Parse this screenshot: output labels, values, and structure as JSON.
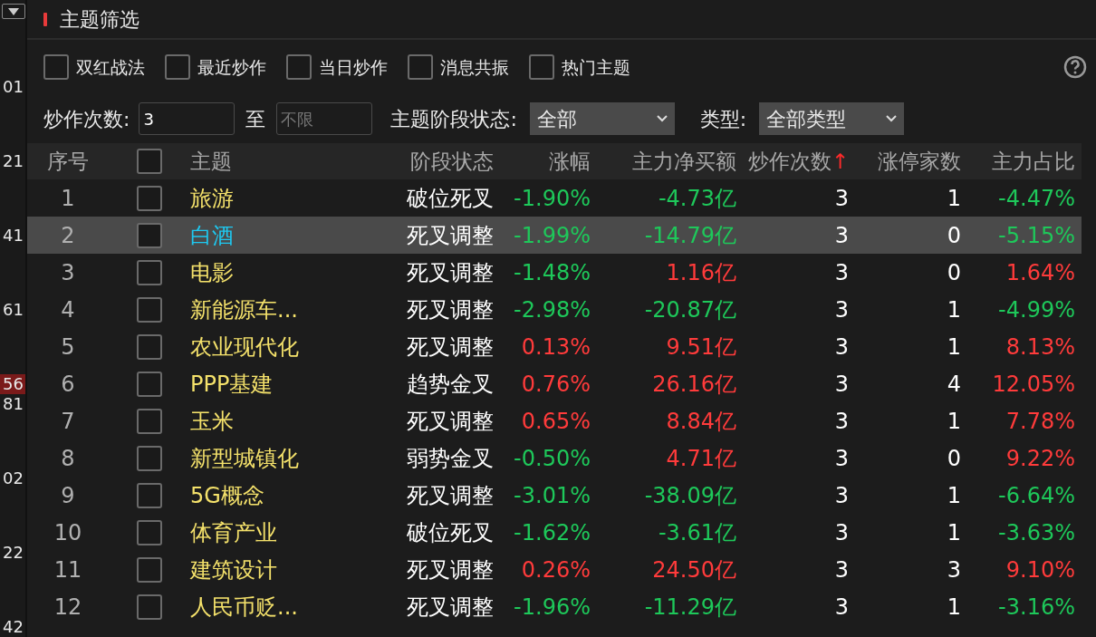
{
  "left_panel": {
    "values": [
      {
        "text": "01",
        "highlighted": false
      },
      {
        "text": "21",
        "highlighted": false
      },
      {
        "text": "41",
        "highlighted": false
      },
      {
        "text": "61",
        "highlighted": false
      },
      {
        "text": "56",
        "highlighted": true
      },
      {
        "text": "81",
        "highlighted": false
      },
      {
        "text": "02",
        "highlighted": false
      },
      {
        "text": "22",
        "highlighted": false
      },
      {
        "text": "42",
        "highlighted": false
      }
    ]
  },
  "title": "主题筛选",
  "filters": [
    {
      "label": "双红战法",
      "checked": false
    },
    {
      "label": "最近炒作",
      "checked": false
    },
    {
      "label": "当日炒作",
      "checked": false
    },
    {
      "label": "消息共振",
      "checked": false
    },
    {
      "label": "热门主题",
      "checked": false
    }
  ],
  "count_filter": {
    "label": "炒作次数:",
    "from_value": "3",
    "to_label": "至",
    "to_placeholder": "不限"
  },
  "stage_filter": {
    "label": "主题阶段状态:",
    "value": "全部"
  },
  "type_filter": {
    "label": "类型:",
    "value": "全部类型"
  },
  "table": {
    "columns": [
      {
        "label": "序号"
      },
      {
        "label": "主题"
      },
      {
        "label": "阶段状态"
      },
      {
        "label": "涨幅"
      },
      {
        "label": "主力净买额"
      },
      {
        "label": "炒作次数",
        "sort_mark": "↑"
      },
      {
        "label": "涨停家数"
      },
      {
        "label": "主力占比"
      }
    ],
    "header_checked": false,
    "rows": [
      {
        "index": "1",
        "checked": false,
        "selected": false,
        "theme": "旅游",
        "stage": "破位死叉",
        "change": {
          "text": "-1.90%",
          "rising": false
        },
        "net_buy": {
          "text": "-4.73亿",
          "rising": false
        },
        "count": "3",
        "limit_up": "1",
        "ratio": {
          "text": "-4.47%",
          "rising": false
        }
      },
      {
        "index": "2",
        "checked": false,
        "selected": true,
        "theme": "白酒",
        "stage": "死叉调整",
        "change": {
          "text": "-1.99%",
          "rising": false
        },
        "net_buy": {
          "text": "-14.79亿",
          "rising": false
        },
        "count": "3",
        "limit_up": "0",
        "ratio": {
          "text": "-5.15%",
          "rising": false
        }
      },
      {
        "index": "3",
        "checked": false,
        "selected": false,
        "theme": "电影",
        "stage": "死叉调整",
        "change": {
          "text": "-1.48%",
          "rising": false
        },
        "net_buy": {
          "text": "1.16亿",
          "rising": true
        },
        "count": "3",
        "limit_up": "0",
        "ratio": {
          "text": "1.64%",
          "rising": true
        }
      },
      {
        "index": "4",
        "checked": false,
        "selected": false,
        "theme": "新能源车...",
        "stage": "死叉调整",
        "change": {
          "text": "-2.98%",
          "rising": false
        },
        "net_buy": {
          "text": "-20.87亿",
          "rising": false
        },
        "count": "3",
        "limit_up": "1",
        "ratio": {
          "text": "-4.99%",
          "rising": false
        }
      },
      {
        "index": "5",
        "checked": false,
        "selected": false,
        "theme": "农业现代化",
        "stage": "死叉调整",
        "change": {
          "text": "0.13%",
          "rising": true
        },
        "net_buy": {
          "text": "9.51亿",
          "rising": true
        },
        "count": "3",
        "limit_up": "1",
        "ratio": {
          "text": "8.13%",
          "rising": true
        }
      },
      {
        "index": "6",
        "checked": false,
        "selected": false,
        "theme": "PPP基建",
        "stage": "趋势金叉",
        "change": {
          "text": "0.76%",
          "rising": true
        },
        "net_buy": {
          "text": "26.16亿",
          "rising": true
        },
        "count": "3",
        "limit_up": "4",
        "ratio": {
          "text": "12.05%",
          "rising": true
        }
      },
      {
        "index": "7",
        "checked": false,
        "selected": false,
        "theme": "玉米",
        "stage": "死叉调整",
        "change": {
          "text": "0.65%",
          "rising": true
        },
        "net_buy": {
          "text": "8.84亿",
          "rising": true
        },
        "count": "3",
        "limit_up": "1",
        "ratio": {
          "text": "7.78%",
          "rising": true
        }
      },
      {
        "index": "8",
        "checked": false,
        "selected": false,
        "theme": "新型城镇化",
        "stage": "弱势金叉",
        "change": {
          "text": "-0.50%",
          "rising": false
        },
        "net_buy": {
          "text": "4.71亿",
          "rising": true
        },
        "count": "3",
        "limit_up": "0",
        "ratio": {
          "text": "9.22%",
          "rising": true
        }
      },
      {
        "index": "9",
        "checked": false,
        "selected": false,
        "theme": "5G概念",
        "stage": "死叉调整",
        "change": {
          "text": "-3.01%",
          "rising": false
        },
        "net_buy": {
          "text": "-38.09亿",
          "rising": false
        },
        "count": "3",
        "limit_up": "1",
        "ratio": {
          "text": "-6.64%",
          "rising": false
        }
      },
      {
        "index": "10",
        "checked": false,
        "selected": false,
        "theme": "体育产业",
        "stage": "破位死叉",
        "change": {
          "text": "-1.62%",
          "rising": false
        },
        "net_buy": {
          "text": "-3.61亿",
          "rising": false
        },
        "count": "3",
        "limit_up": "1",
        "ratio": {
          "text": "-3.63%",
          "rising": false
        }
      },
      {
        "index": "11",
        "checked": false,
        "selected": false,
        "theme": "建筑设计",
        "stage": "死叉调整",
        "change": {
          "text": "0.26%",
          "rising": true
        },
        "net_buy": {
          "text": "24.50亿",
          "rising": true
        },
        "count": "3",
        "limit_up": "3",
        "ratio": {
          "text": "9.10%",
          "rising": true
        }
      },
      {
        "index": "12",
        "checked": false,
        "selected": false,
        "theme": "人民币贬...",
        "stage": "死叉调整",
        "change": {
          "text": "-1.96%",
          "rising": false
        },
        "net_buy": {
          "text": "-11.29亿",
          "rising": false
        },
        "count": "3",
        "limit_up": "1",
        "ratio": {
          "text": "-3.16%",
          "rising": false
        }
      }
    ]
  }
}
